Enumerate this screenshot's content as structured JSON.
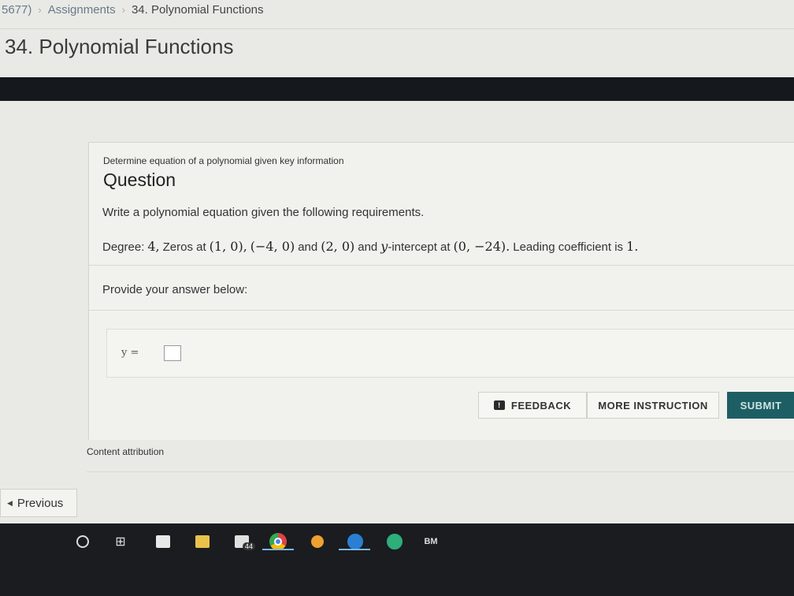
{
  "breadcrumb": {
    "items": [
      "5677)",
      "Assignments",
      "34. Polynomial Functions"
    ],
    "separator": "›"
  },
  "page_title": "34. Polynomial Functions",
  "question": {
    "subtitle": "Determine equation of a polynomial given key information",
    "heading": "Question",
    "text": "Write a polynomial equation given the following requirements.",
    "requirements": {
      "degree_label": "Degree:",
      "degree_value": "4,",
      "zeros_label": "Zeros at",
      "zero1": "(1, 0),",
      "zero2": "(−4, 0)",
      "and1": "and",
      "zero3": "(2, 0)",
      "and2": "and",
      "y_var": "y",
      "intercept_label": "-intercept at",
      "intercept_value": "(0, −24).",
      "leading_label": "Leading coefficient is",
      "leading_value": "1."
    },
    "prompt": "Provide your answer below:",
    "answer_label": "y ="
  },
  "buttons": {
    "feedback": "FEEDBACK",
    "more_instruction": "MORE INSTRUCTION",
    "submit": "SUBMIT"
  },
  "attribution": "Content attribution",
  "navigation": {
    "previous": "Previous"
  },
  "taskbar": {
    "mail_badge": "44",
    "icons": [
      "start-circle-icon",
      "task-view-icon",
      "store-icon",
      "file-explorer-icon",
      "mail-icon",
      "chrome-icon",
      "clock-app-icon",
      "word-icon",
      "calculator-icon",
      "bm-app-icon"
    ],
    "bm_label": "BM"
  },
  "colors": {
    "submit_bg": "#1d5e64",
    "taskbar_bg": "#1a1c20",
    "dark_band": "#15191d"
  }
}
